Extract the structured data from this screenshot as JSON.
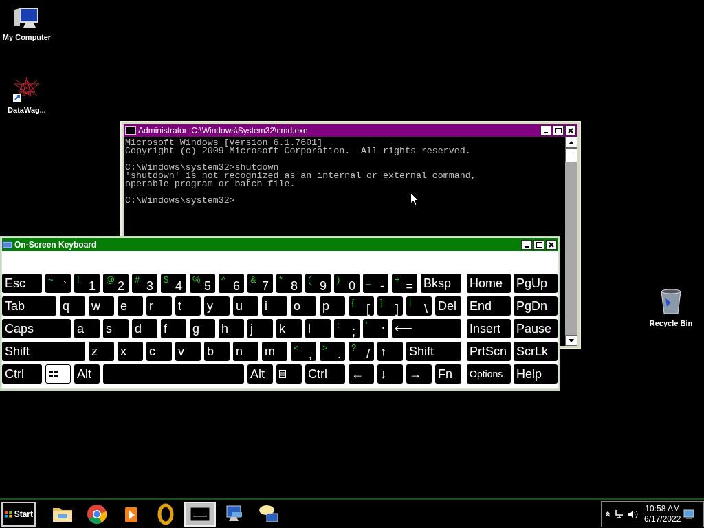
{
  "desktop_icons": [
    {
      "label": "My Computer",
      "kind": "computer"
    },
    {
      "label": "DataWag...",
      "kind": "shortcut"
    },
    {
      "label": "Recycle Bin",
      "kind": "recycle"
    }
  ],
  "cmd_window": {
    "title": "Administrator: C:\\Windows\\System32\\cmd.exe",
    "blocks": [
      [
        "Microsoft Windows [Version 6.1.7601]",
        "Copyright (c) 2009 Microsoft Corporation.  All rights reserved."
      ],
      [
        "C:\\Windows\\system32>shutdown",
        "'shutdown' is not recognized as an internal or external command,",
        "operable program or batch file."
      ],
      [
        "C:\\Windows\\system32>"
      ]
    ]
  },
  "keyboard_window": {
    "title": "On-Screen Keyboard",
    "main_rows": [
      [
        {
          "label": "Esc",
          "pressed": false
        },
        {
          "shift": "~",
          "label": "`",
          "pressed": false
        },
        {
          "shift": "!",
          "label": "1",
          "pressed": false
        },
        {
          "shift": "@",
          "label": "2",
          "pressed": false
        },
        {
          "shift": "#",
          "label": "3",
          "pressed": false
        },
        {
          "shift": "$",
          "label": "4",
          "pressed": false
        },
        {
          "shift": "%",
          "label": "5",
          "pressed": false
        },
        {
          "shift": "^",
          "label": "6",
          "pressed": false
        },
        {
          "shift": "&",
          "label": "7",
          "pressed": false
        },
        {
          "shift": "*",
          "label": "8",
          "pressed": false
        },
        {
          "shift": "(",
          "label": "9",
          "pressed": false
        },
        {
          "shift": ")",
          "label": "0",
          "pressed": false
        },
        {
          "shift": "_",
          "label": "-",
          "pressed": false
        },
        {
          "shift": "+",
          "label": "=",
          "pressed": false
        },
        {
          "label": "Bksp",
          "pressed": false
        }
      ],
      [
        {
          "label": "Tab",
          "pressed": false
        },
        {
          "label": "q",
          "pressed": false
        },
        {
          "label": "w",
          "pressed": false
        },
        {
          "label": "e",
          "pressed": false
        },
        {
          "label": "r",
          "pressed": false
        },
        {
          "label": "t",
          "pressed": false
        },
        {
          "label": "y",
          "pressed": false
        },
        {
          "label": "u",
          "pressed": false
        },
        {
          "label": "i",
          "pressed": false
        },
        {
          "label": "o",
          "pressed": false
        },
        {
          "label": "p",
          "pressed": false
        },
        {
          "shift": "{",
          "label": "[",
          "pressed": false
        },
        {
          "shift": "}",
          "label": "]",
          "pressed": false
        },
        {
          "shift": "|",
          "label": "\\",
          "pressed": false
        },
        {
          "label": "Del",
          "pressed": false
        }
      ],
      [
        {
          "label": "Caps",
          "pressed": false
        },
        {
          "label": "a",
          "pressed": false
        },
        {
          "label": "s",
          "pressed": false
        },
        {
          "label": "d",
          "pressed": false
        },
        {
          "label": "f",
          "pressed": false
        },
        {
          "label": "g",
          "pressed": false
        },
        {
          "label": "h",
          "pressed": false
        },
        {
          "label": "j",
          "pressed": false
        },
        {
          "label": "k",
          "pressed": false
        },
        {
          "label": "l",
          "pressed": false
        },
        {
          "shift": ":",
          "label": ";",
          "pressed": false
        },
        {
          "shift": "\"",
          "label": "'",
          "pressed": false
        },
        {
          "label": "⟵",
          "pressed": false
        }
      ],
      [
        {
          "label": "Shift",
          "pressed": false
        },
        {
          "label": "z",
          "pressed": false
        },
        {
          "label": "x",
          "pressed": false
        },
        {
          "label": "c",
          "pressed": false
        },
        {
          "label": "v",
          "pressed": false
        },
        {
          "label": "b",
          "pressed": false
        },
        {
          "label": "n",
          "pressed": false
        },
        {
          "label": "m",
          "pressed": false
        },
        {
          "shift": "<",
          "label": ",",
          "pressed": false
        },
        {
          "shift": ">",
          "label": ".",
          "pressed": false
        },
        {
          "shift": "?",
          "label": "/",
          "pressed": false
        },
        {
          "label": "↑",
          "pressed": false
        },
        {
          "label": "Shift",
          "pressed": false
        }
      ],
      [
        {
          "label": "Ctrl",
          "pressed": false
        },
        {
          "kind": "windows",
          "pressed": true
        },
        {
          "label": "Alt",
          "pressed": false
        },
        {
          "kind": "space",
          "pressed": false
        },
        {
          "label": "Alt",
          "pressed": false
        },
        {
          "kind": "menu",
          "pressed": false
        },
        {
          "label": "Ctrl",
          "pressed": false
        },
        {
          "label": "←",
          "pressed": false
        },
        {
          "label": "↓",
          "pressed": false
        },
        {
          "label": "→",
          "pressed": false
        },
        {
          "label": "Fn",
          "pressed": false
        }
      ]
    ],
    "nav_rows": [
      [
        {
          "label": "Home",
          "pressed": false
        },
        {
          "label": "PgUp",
          "pressed": false
        }
      ],
      [
        {
          "label": "End",
          "pressed": false
        },
        {
          "label": "PgDn",
          "pressed": false
        }
      ],
      [
        {
          "label": "Insert",
          "pressed": false
        },
        {
          "label": "Pause",
          "pressed": false
        }
      ],
      [
        {
          "label": "PrtScn",
          "pressed": false
        },
        {
          "label": "ScrLk",
          "pressed": false
        }
      ],
      [
        {
          "label": "Options",
          "kind": "small",
          "pressed": false
        },
        {
          "label": "Help",
          "pressed": false
        }
      ]
    ]
  },
  "taskbar": {
    "start": "Start",
    "apps": [
      {
        "kind": "folder",
        "selected": false
      },
      {
        "kind": "chrome",
        "selected": false
      },
      {
        "kind": "media",
        "selected": false
      },
      {
        "kind": "ring",
        "selected": false
      },
      {
        "kind": "console",
        "selected": true
      },
      {
        "kind": "monitor",
        "selected": false
      },
      {
        "kind": "chat",
        "selected": false
      }
    ],
    "time": "10:58 AM",
    "date": "6/17/2022"
  }
}
